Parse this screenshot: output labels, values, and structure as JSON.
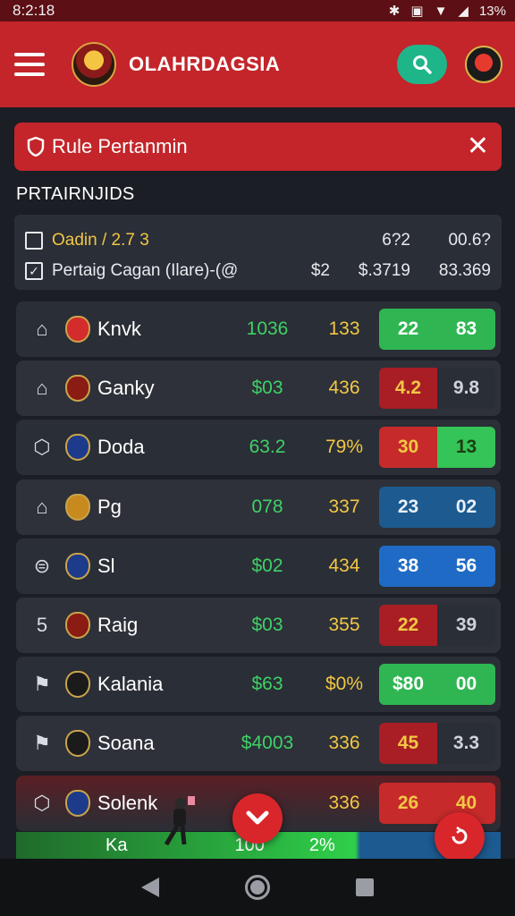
{
  "status_bar": {
    "time": "8:2:18",
    "battery": "13%",
    "icons": [
      "bluetooth-icon",
      "vibrate-icon",
      "wifi-icon",
      "signal-icon",
      "battery-icon"
    ]
  },
  "app_bar": {
    "title": "OLAHRDAGSIA",
    "menu_icon": "hamburger-icon",
    "search_icon": "search-icon"
  },
  "alert": {
    "text": "Rule Pertanmin",
    "icon": "shield-icon",
    "close": "✕"
  },
  "section_title": "PRTAIRNJIDS",
  "summary": {
    "rows": [
      {
        "checked": false,
        "label": "Oadin / 2.7 3",
        "v1": "",
        "v2": "6?2",
        "v3": "00.6?"
      },
      {
        "checked": true,
        "label": "Pertaig Cagan (Ilare)-(@",
        "v1": "$2",
        "v2": "$.3719",
        "v3": "83.369"
      }
    ]
  },
  "rows": [
    {
      "team": "Knvk",
      "v1": "1036",
      "v2": "133",
      "odds": [
        "22",
        "83"
      ],
      "odds_style": [
        "green",
        "green"
      ],
      "icon": "home-icon",
      "crest_color": "#d42c2c"
    },
    {
      "team": "Ganky",
      "v1": "$03",
      "v2": "436",
      "odds": [
        "4.2",
        "9.8"
      ],
      "odds_style": [
        "red",
        "dark"
      ],
      "icon": "home-icon",
      "crest_color": "#8a1c14"
    },
    {
      "team": "Doda",
      "v1": "63.2",
      "v2": "79%",
      "odds": [
        "30",
        "13"
      ],
      "odds_style": [
        "red2",
        "green2"
      ],
      "icon": "shield-outline-icon",
      "crest_color": "#1d3b8a"
    },
    {
      "team": "Pg",
      "v1": "078",
      "v2": "337",
      "odds": [
        "23",
        "02"
      ],
      "odds_style": [
        "blue",
        "blue"
      ],
      "icon": "home-icon",
      "crest_color": "#c88a1f"
    },
    {
      "team": "Sl",
      "v1": "$02",
      "v2": "434",
      "odds": [
        "38",
        "56"
      ],
      "odds_style": [
        "blue2",
        "blue2"
      ],
      "icon": "ball-icon",
      "crest_color": "#1d3b8a"
    },
    {
      "team": "Raig",
      "v1": "$03",
      "v2": "355",
      "odds": [
        "22",
        "39"
      ],
      "odds_style": [
        "red",
        "dark"
      ],
      "icon": "number-five-icon",
      "crest_color": "#8a1c14"
    },
    {
      "team": "Kalania",
      "v1": "$63",
      "v2": "$0%",
      "odds": [
        "$80",
        "00"
      ],
      "odds_style": [
        "green",
        "green"
      ],
      "icon": "flag-icon",
      "crest_color": "#1b1b1b"
    },
    {
      "team": "Soana",
      "v1": "$4003",
      "v2": "336",
      "odds": [
        "45",
        "3.3"
      ],
      "odds_style": [
        "red",
        "dark"
      ],
      "icon": "flag-icon",
      "crest_color": "#1b1b1b"
    },
    {
      "team": "Solenk",
      "v1": "",
      "v2": "336",
      "odds": [
        "26",
        "40"
      ],
      "odds_style": [
        "red2",
        "red2"
      ],
      "icon": "shield-outline-icon",
      "crest_color": "#1d3b8a"
    }
  ],
  "partial_row": {
    "team": "Ka",
    "v1": "100",
    "v2": "2%"
  },
  "fab_down_icon": "chevron-down-icon",
  "fab_refresh_icon": "refresh-icon",
  "nav": {
    "back": "back-icon",
    "home": "home-button-icon",
    "recent": "recents-icon"
  }
}
